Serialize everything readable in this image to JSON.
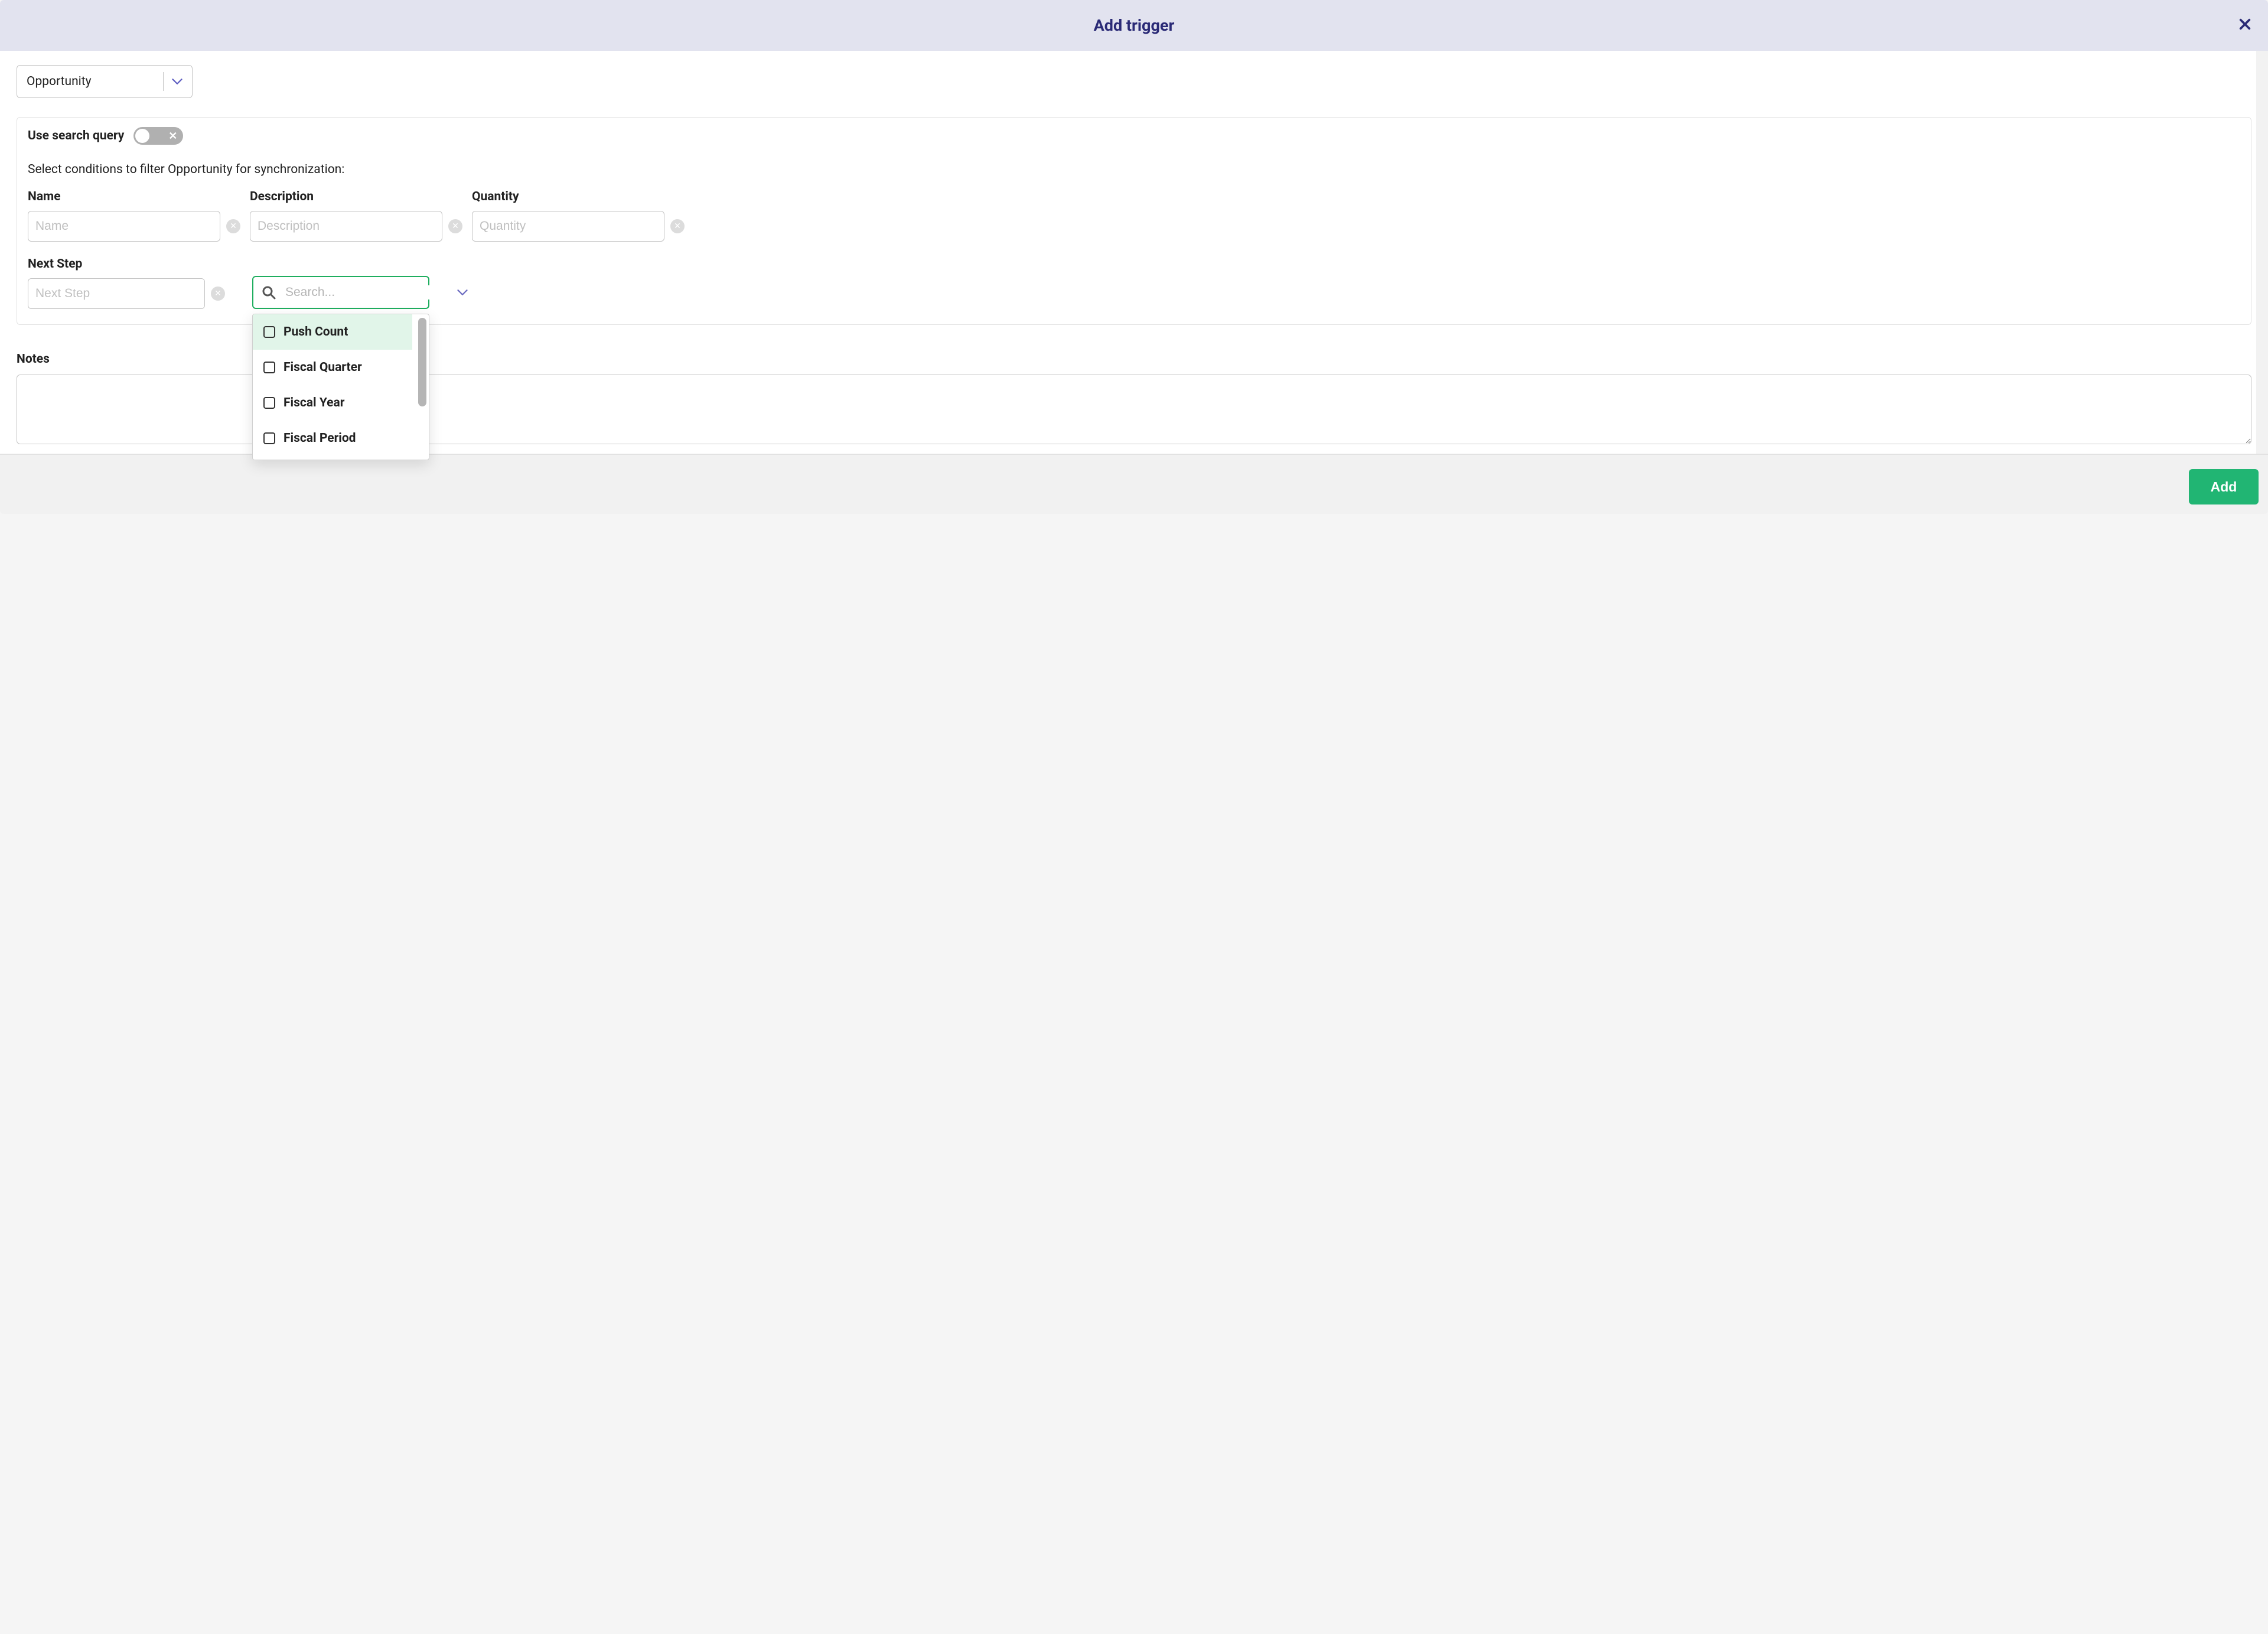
{
  "header": {
    "title": "Add trigger"
  },
  "object_select": {
    "value": "Opportunity"
  },
  "conditions": {
    "use_search_label": "Use search query",
    "use_search_on": false,
    "instruction": "Select conditions to filter Opportunity for synchronization:",
    "fields": [
      {
        "label": "Name",
        "placeholder": "Name",
        "value": ""
      },
      {
        "label": "Description",
        "placeholder": "Description",
        "value": ""
      },
      {
        "label": "Quantity",
        "placeholder": "Quantity",
        "value": ""
      }
    ],
    "next_step": {
      "label": "Next Step",
      "placeholder": "Next Step",
      "value": ""
    },
    "field_search": {
      "placeholder": "Search...",
      "value": "",
      "options": [
        {
          "label": "Push Count",
          "checked": false,
          "highlighted": true
        },
        {
          "label": "Fiscal Quarter",
          "checked": false,
          "highlighted": false
        },
        {
          "label": "Fiscal Year",
          "checked": false,
          "highlighted": false
        },
        {
          "label": "Fiscal Period",
          "checked": false,
          "highlighted": false
        }
      ]
    }
  },
  "notes": {
    "label": "Notes",
    "value": ""
  },
  "footer": {
    "add_label": "Add"
  },
  "colors": {
    "header_bg": "#e2e3ef",
    "title_color": "#2a2a76",
    "accent_green": "#21b573",
    "focus_green": "#1fae5f",
    "highlight_green": "#e1f5e9"
  }
}
